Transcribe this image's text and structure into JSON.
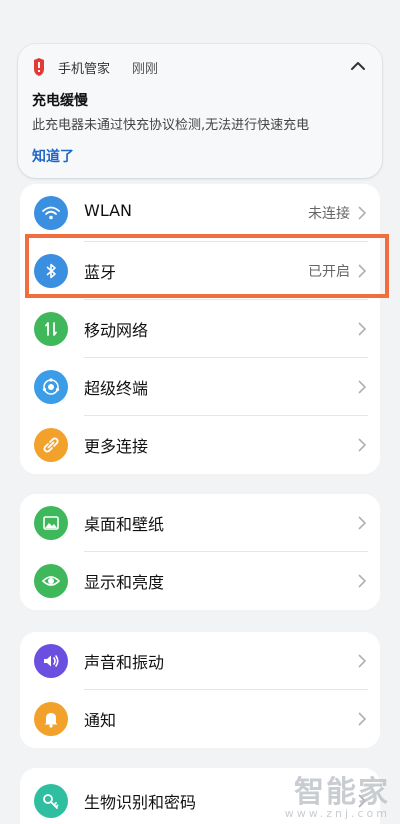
{
  "notification": {
    "app_name": "手机管家",
    "time": "刚刚",
    "title": "充电缓慢",
    "body": "此充电器未通过快充协议检测,无法进行快速充电",
    "action": "知道了"
  },
  "groups": {
    "connectivity": [
      {
        "label": "WLAN",
        "value": "未连接",
        "icon": "wifi-icon",
        "color": "#3b8fe0"
      },
      {
        "label": "蓝牙",
        "value": "已开启",
        "icon": "bluetooth-icon",
        "color": "#3b8fe0"
      },
      {
        "label": "移动网络",
        "value": "",
        "icon": "mobile-network-icon",
        "color": "#3fb75b"
      },
      {
        "label": "超级终端",
        "value": "",
        "icon": "super-device-icon",
        "color": "#3b9de8"
      },
      {
        "label": "更多连接",
        "value": "",
        "icon": "link-icon",
        "color": "#f2a12b"
      }
    ],
    "display": [
      {
        "label": "桌面和壁纸",
        "icon": "wallpaper-icon",
        "color": "#3fb75b"
      },
      {
        "label": "显示和亮度",
        "icon": "eye-icon",
        "color": "#3fb75b"
      }
    ],
    "sound": [
      {
        "label": "声音和振动",
        "icon": "speaker-icon",
        "color": "#6a4fe0"
      },
      {
        "label": "通知",
        "icon": "bell-icon",
        "color": "#f2a12b"
      }
    ],
    "security": [
      {
        "label": "生物识别和密码",
        "icon": "key-icon",
        "color": "#2fbfa0"
      }
    ]
  },
  "watermark": {
    "big": "智能家",
    "small": "www.znj.com"
  },
  "colors": {
    "highlight": "#f26d3d",
    "link": "#1f66c9",
    "app_icon": "#e53935"
  }
}
